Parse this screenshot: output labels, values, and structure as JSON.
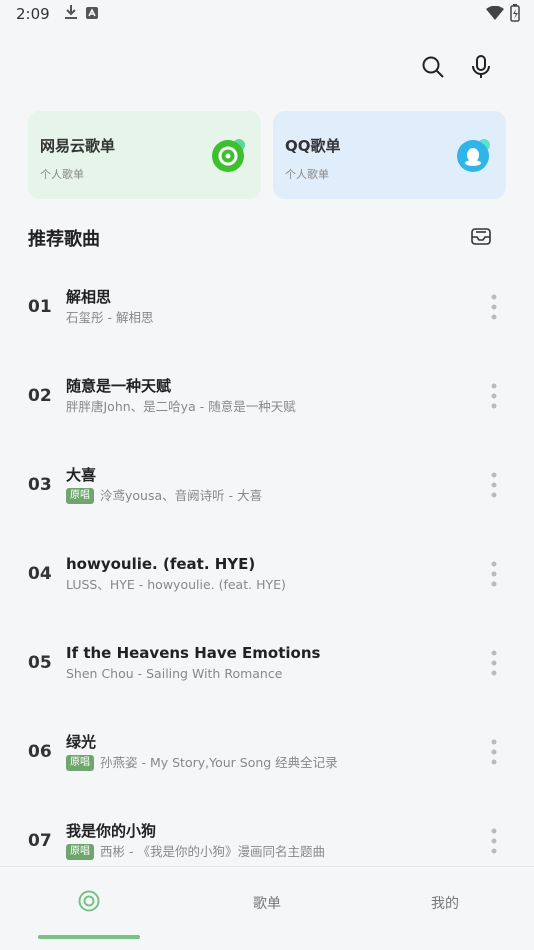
{
  "status": {
    "time": "2:09"
  },
  "cards": [
    {
      "title": "网易云歌单",
      "subtitle": "个人歌单"
    },
    {
      "title": "QQ歌单",
      "subtitle": "个人歌单"
    }
  ],
  "section": {
    "title": "推荐歌曲"
  },
  "songs": [
    {
      "rank": "01",
      "title": "解相思",
      "subtitle": "石玺彤 - 解相思",
      "badge": ""
    },
    {
      "rank": "02",
      "title": "随意是一种天赋",
      "subtitle": "胖胖唐John、是二哈ya - 随意是一种天赋",
      "badge": ""
    },
    {
      "rank": "03",
      "title": "大喜",
      "subtitle": "泠鸢yousa、音阙诗听 - 大喜",
      "badge": "原唱"
    },
    {
      "rank": "04",
      "title": "howyoulie. (feat. HYE)",
      "subtitle": "LUSS、HYE - howyoulie. (feat. HYE)",
      "badge": ""
    },
    {
      "rank": "05",
      "title": "If the Heavens Have Emotions",
      "subtitle": "Shen Chou - Sailing With Romance",
      "badge": ""
    },
    {
      "rank": "06",
      "title": "绿光",
      "subtitle": "孙燕姿 - My Story,Your Song 经典全记录",
      "badge": "原唱"
    },
    {
      "rank": "07",
      "title": "我是你的小狗",
      "subtitle": "西彬 - 《我是你的小狗》漫画同名主题曲",
      "badge": "原唱"
    }
  ],
  "nav": [
    {
      "label": "",
      "icon": "home-icon"
    },
    {
      "label": "歌单"
    },
    {
      "label": "我的"
    }
  ],
  "colors": {
    "accent": "#77c284",
    "badge": "#6fa66d",
    "netease_card": "#e6f4e9",
    "qq_card": "#e0eefc"
  }
}
